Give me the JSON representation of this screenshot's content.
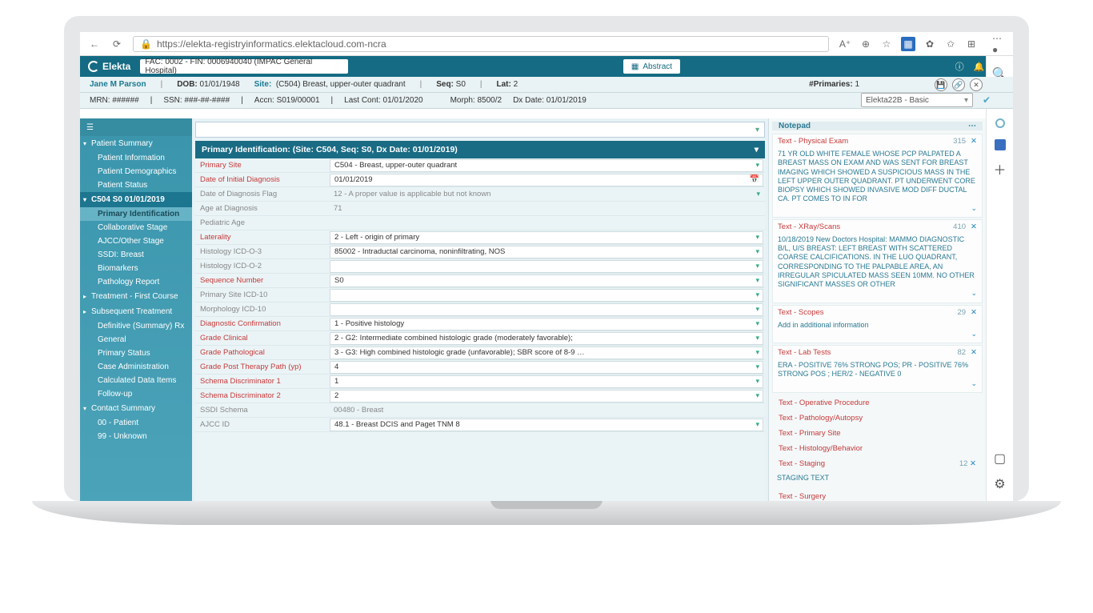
{
  "browser": {
    "url": "https://elekta-registryinformatics.elektacloud.com-ncra"
  },
  "appbar": {
    "brand": "Elekta",
    "facility": "FAC: 0002 - FIN: 0006940040 (IMPAC General Hospital)",
    "abstract_btn": "Abstract"
  },
  "banner": {
    "name": "Jane M Parson",
    "dob_lbl": "DOB:",
    "dob": "01/01/1948",
    "site_lbl": "Site:",
    "site": "(C504) Breast, upper-outer quadrant",
    "seq_lbl": "Seq:",
    "seq": "S0",
    "lat_lbl": "Lat:",
    "lat": "2",
    "prim_lbl": "#Primaries:",
    "prim": "1",
    "mrn_lbl": "MRN:",
    "mrn": "######",
    "ssn_lbl": "SSN:",
    "ssn": "###-##-####",
    "accn_lbl": "Accn:",
    "accn": "S019/00001",
    "lc_lbl": "Last Cont:",
    "lc": "01/01/2020",
    "morph_lbl": "Morph:",
    "morph": "8500/2",
    "dx_lbl": "Dx Date:",
    "dx": "01/01/2019",
    "schema": "Elekta22B - Basic"
  },
  "sidebar": {
    "s0": "Patient Summary",
    "s0i": [
      "Patient Information",
      "Patient Demographics",
      "Patient Status"
    ],
    "s1": "C504 S0 01/01/2019",
    "s1i": [
      "Primary Identification",
      "Collaborative Stage",
      "AJCC/Other Stage",
      "SSDI: Breast",
      "Biomarkers",
      "Pathology Report"
    ],
    "s2": "Treatment - First Course",
    "s3": "Subsequent Treatment",
    "s3i": [
      "Definitive (Summary) Rx",
      "General",
      "Primary Status",
      "Case Administration",
      "Calculated Data Items",
      "Follow-up"
    ],
    "s4": "Contact Summary",
    "s4i": [
      "00 - Patient",
      "99 - Unknown"
    ]
  },
  "form": {
    "header": "Primary Identification: (Site: C504, Seq: S0, Dx Date: 01/01/2019)",
    "rows": [
      {
        "l": "Primary Site",
        "v": "C504 - Breast, upper-outer quadrant",
        "red": true,
        "dd": true
      },
      {
        "l": "Date of Initial Diagnosis",
        "v": "01/01/2019",
        "red": true,
        "cal": true
      },
      {
        "l": "Date of Diagnosis Flag",
        "v": "12 - A proper value is applicable but not known",
        "gray": true,
        "dd": true,
        "ro": true
      },
      {
        "l": "Age at Diagnosis",
        "v": "71",
        "gray": true,
        "ro": true
      },
      {
        "l": "Pediatric Age",
        "v": "",
        "gray": true,
        "ro": true
      },
      {
        "l": "Laterality",
        "v": "2 - Left - origin of primary",
        "red": true,
        "dd": true
      },
      {
        "l": "Histology ICD-O-3",
        "v": "85002 - Intraductal carcinoma, noninfiltrating, NOS",
        "gray": true,
        "dd": true
      },
      {
        "l": "Histology ICD-O-2",
        "v": "",
        "gray": true,
        "dd": true
      },
      {
        "l": "Sequence Number",
        "v": "S0",
        "red": true,
        "dd": true
      },
      {
        "l": "Primary Site ICD-10",
        "v": "",
        "gray": true,
        "dd": true
      },
      {
        "l": "Morphology ICD-10",
        "v": "",
        "gray": true,
        "dd": true
      },
      {
        "l": "Diagnostic Confirmation",
        "v": "1 - Positive histology",
        "red": true,
        "dd": true
      },
      {
        "l": "Grade Clinical",
        "v": "2 - G2: Intermediate combined histologic grade (moderately favorable);",
        "red": true,
        "dd": true
      },
      {
        "l": "Grade Pathological",
        "v": "3 - G3: High combined histologic grade (unfavorable); SBR score of 8-9 …",
        "red": true,
        "dd": true
      },
      {
        "l": "Grade Post Therapy Path (yp)",
        "v": "4",
        "red": true,
        "dd": true
      },
      {
        "l": "Schema Discriminator 1",
        "v": "1",
        "red": true,
        "dd": true
      },
      {
        "l": "Schema Discriminator 2",
        "v": "2",
        "red": true,
        "dd": true
      },
      {
        "l": "SSDI Schema",
        "v": "00480 - Breast",
        "gray": true,
        "ro": true
      },
      {
        "l": "AJCC ID",
        "v": "48.1 - Breast DCIS and Paget TNM 8",
        "gray": true,
        "dd": true
      }
    ]
  },
  "notepad": {
    "title": "Notepad",
    "items": [
      {
        "t": "Text - Physical Exam",
        "n": "315",
        "b": "71 YR OLD WHITE FEMALE WHOSE PCP PALPATED A BREAST MASS ON EXAM AND WAS SENT FOR BREAST IMAGING WHICH SHOWED A SUSPICIOUS MASS IN THE LEFT UPPER OUTER QUADRANT.  PT UNDERWENT CORE BIOPSY WHICH SHOWED INVASIVE MOD DIFF DUCTAL CA.  PT COMES TO IN FOR"
      },
      {
        "t": "Text - XRay/Scans",
        "n": "410",
        "b": "10/18/2019 New Doctors Hospital: MAMMO DIAGNOSTIC B/L, U/S BREAST: LEFT BREAST WITH SCATTERED COARSE CALCIFICATIONS. IN THE LUO QUADRANT, CORRESPONDING TO THE PALPABLE AREA, AN IRREGULAR SPICULATED MASS SEEN 10MM.  NO OTHER SIGNIFICANT MASSES OR OTHER"
      },
      {
        "t": "Text - Scopes",
        "n": "29",
        "b": "Add in additional information"
      },
      {
        "t": "Text - Lab Tests",
        "n": "82",
        "b": "ERA - POSITIVE 76% STRONG POS; PR - POSITIVE 76%  STRONG POS ;  HER/2 - NEGATIVE 0"
      }
    ],
    "links": [
      {
        "t": "Text - Operative Procedure"
      },
      {
        "t": "Text - Pathology/Autopsy"
      },
      {
        "t": "Text - Primary Site"
      },
      {
        "t": "Text - Histology/Behavior"
      },
      {
        "t": "Text - Staging",
        "n": "12",
        "b": "STAGING TEXT"
      },
      {
        "t": "Text - Surgery"
      }
    ]
  }
}
